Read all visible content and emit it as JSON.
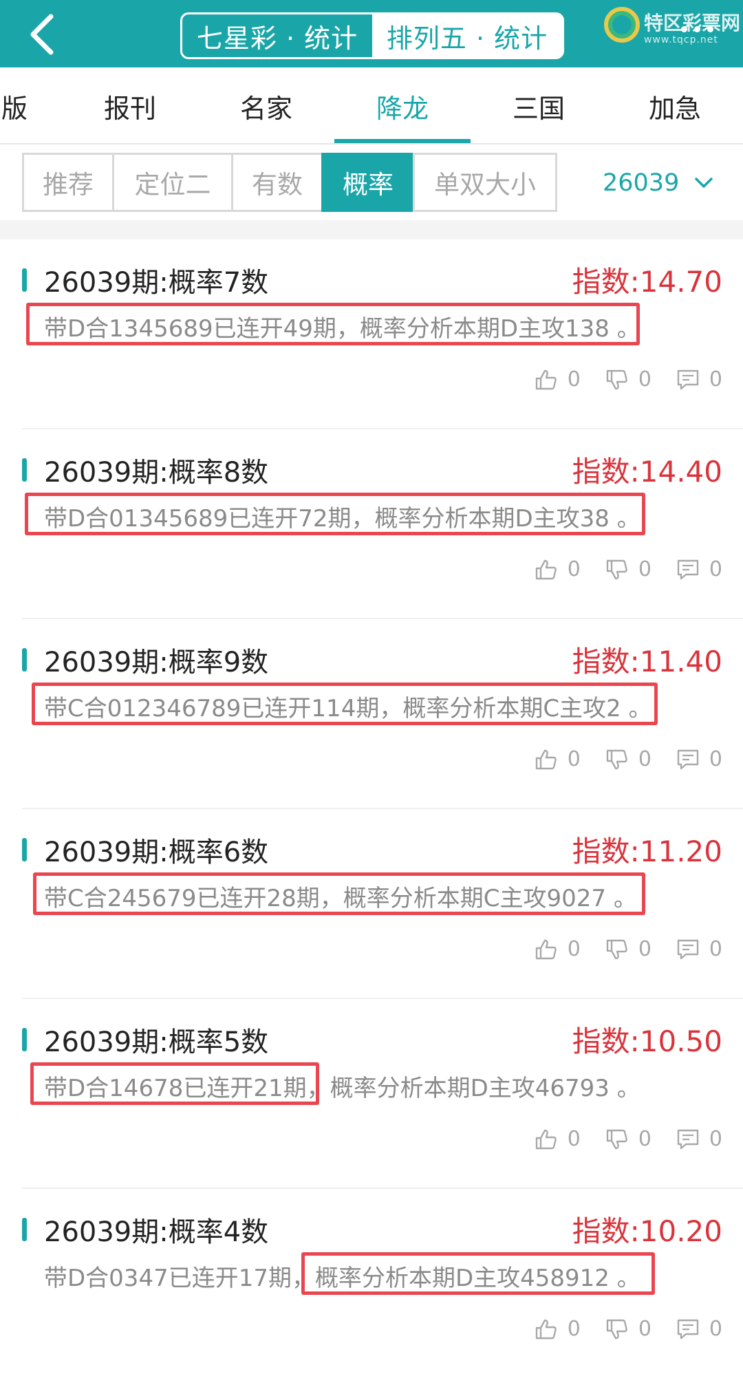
{
  "header": {
    "tab_left": "七星彩 · 统计",
    "tab_right": "排列五 · 统计",
    "logo_text": "特区彩票网",
    "logo_url": "www.tqcp.net",
    "icons": [
      "back-icon",
      "more-icon"
    ]
  },
  "nav": {
    "tabs": [
      "版",
      "报刊",
      "名家",
      "降龙",
      "三国",
      "加急"
    ],
    "active": "降龙"
  },
  "filter": {
    "chips": [
      "推荐",
      "定位二",
      "有数",
      "概率",
      "单双大小"
    ],
    "active": "概率",
    "issue": "26039"
  },
  "posts": [
    {
      "title": "26039期:概率7数",
      "index": "指数:14.70",
      "body": "带D合1345689已连开49期，概率分析本期D主攻138 。",
      "likes": "0",
      "dislikes": "0",
      "comments": "0"
    },
    {
      "title": "26039期:概率8数",
      "index": "指数:14.40",
      "body": "带D合01345689已连开72期，概率分析本期D主攻38 。",
      "likes": "0",
      "dislikes": "0",
      "comments": "0"
    },
    {
      "title": "26039期:概率9数",
      "index": "指数:11.40",
      "body": "带C合012346789已连开114期，概率分析本期C主攻2 。",
      "likes": "0",
      "dislikes": "0",
      "comments": "0"
    },
    {
      "title": "26039期:概率6数",
      "index": "指数:11.20",
      "body": "带C合245679已连开28期，概率分析本期C主攻9027 。",
      "likes": "0",
      "dislikes": "0",
      "comments": "0"
    },
    {
      "title": "26039期:概率5数",
      "index": "指数:10.50",
      "body": "带D合14678已连开21期，概率分析本期D主攻46793 。",
      "likes": "0",
      "dislikes": "0",
      "comments": "0"
    },
    {
      "title": "26039期:概率4数",
      "index": "指数:10.20",
      "body": "带D合0347已连开17期，概率分析本期D主攻458912 。",
      "likes": "0",
      "dislikes": "0",
      "comments": "0"
    }
  ],
  "colors": {
    "brand": "#1aa6a8",
    "index_red": "#d9343c",
    "highlight_red": "#ea4650"
  }
}
